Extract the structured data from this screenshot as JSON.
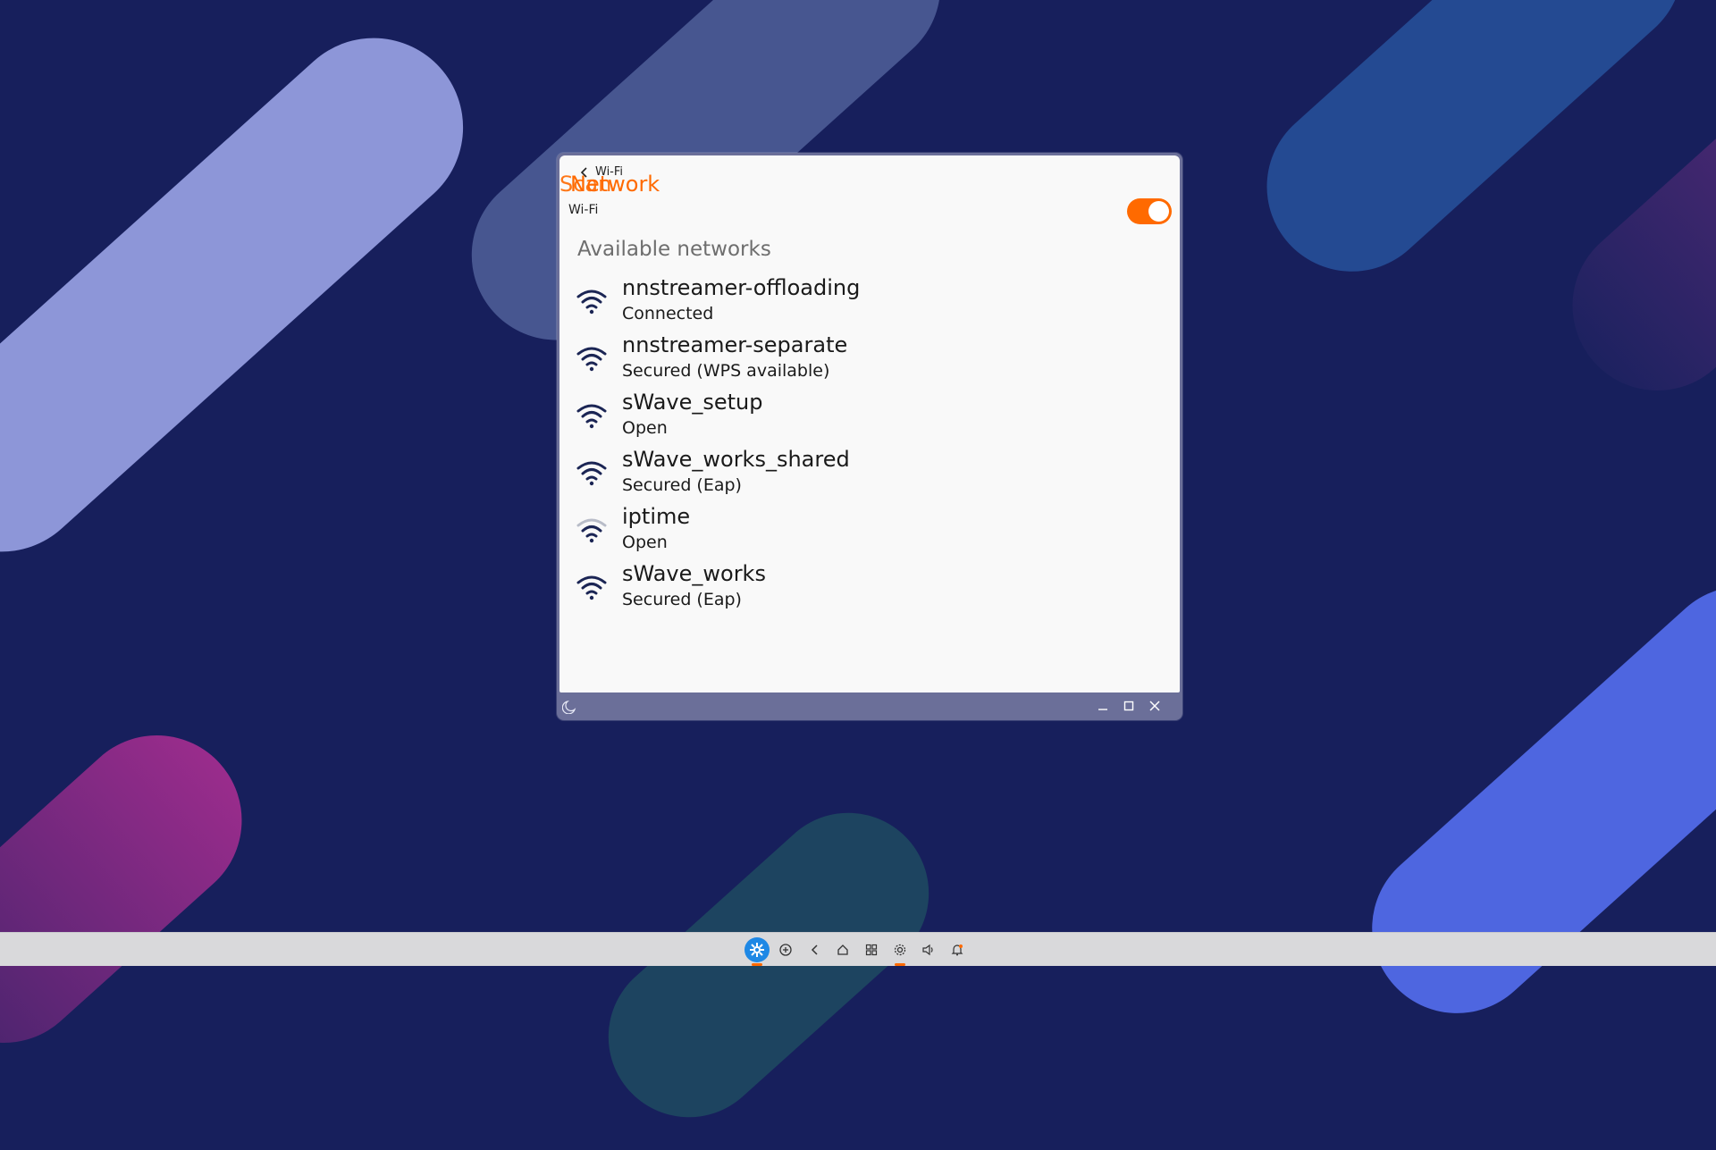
{
  "window": {
    "breadcrumb": "Wi-Fi",
    "title_back": "Scan",
    "title": "Network",
    "wifi_label": "Wi-Fi",
    "wifi_enabled": true,
    "section_heading": "Available networks"
  },
  "networks": [
    {
      "name": "nnstreamer-offloading",
      "status": "Connected",
      "signal": "strong"
    },
    {
      "name": "nnstreamer-separate",
      "status": "Secured (WPS available)",
      "signal": "strong"
    },
    {
      "name": "sWave_setup",
      "status": "Open",
      "signal": "strong"
    },
    {
      "name": "sWave_works_shared",
      "status": "Secured (Eap)",
      "signal": "strong"
    },
    {
      "name": "iptime",
      "status": "Open",
      "signal": "weak"
    },
    {
      "name": "sWave_works",
      "status": "Secured (Eap)",
      "signal": "strong"
    }
  ],
  "colors": {
    "accent": "#ff6a00",
    "desktop": "#171f5c",
    "window_frame": "#6b6f99",
    "wifi_strong": "#1b2554",
    "wifi_weak": "#b8bcc8"
  },
  "icons": {
    "window_controls": [
      "minimize-icon",
      "maximize-icon",
      "close-icon"
    ],
    "taskbar": [
      "app-launcher-icon",
      "add-circle-icon",
      "back-icon",
      "home-icon",
      "apps-grid-icon",
      "settings-icon",
      "volume-icon",
      "notification-bell-icon"
    ]
  }
}
